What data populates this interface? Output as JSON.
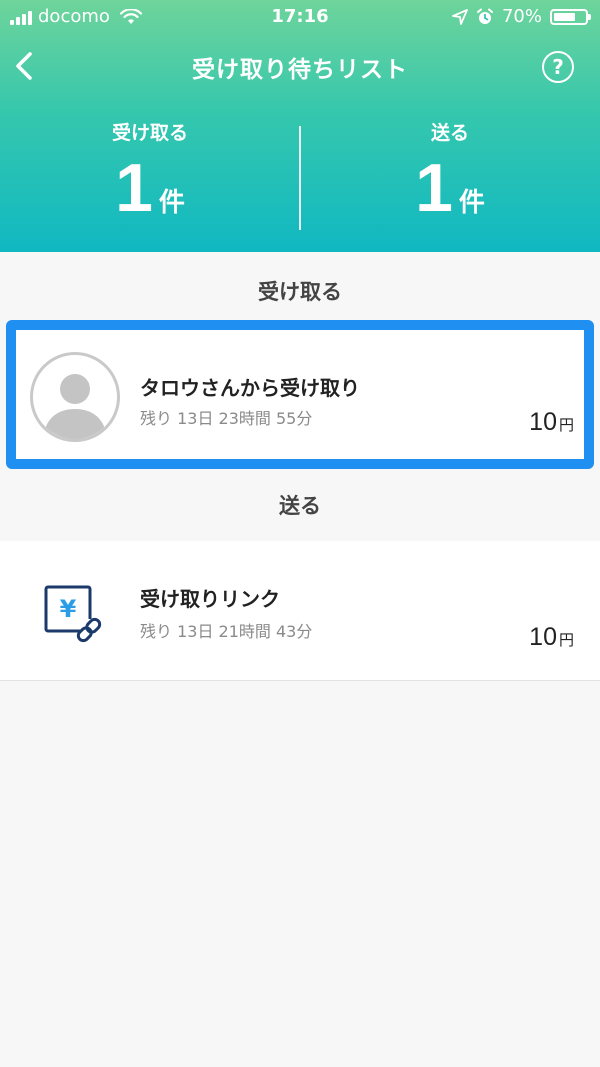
{
  "status_bar": {
    "carrier": "docomo",
    "time": "17:16",
    "battery": "70%",
    "battery_level": 0.7
  },
  "nav": {
    "title": "受け取り待ちリスト",
    "help_label": "?",
    "back_icon": "chevron-left-icon"
  },
  "summary": {
    "receive_label": "受け取る",
    "receive_count": "1",
    "send_label": "送る",
    "send_count": "1",
    "unit": "件"
  },
  "receive_section": {
    "title": "受け取る",
    "item": {
      "title": "タロウさんから受け取り",
      "remaining": "残り 13日 23時間 55分",
      "amount": "10",
      "currency": "円",
      "icon": "avatar-icon"
    }
  },
  "send_section": {
    "title": "送る",
    "item": {
      "title": "受け取りリンク",
      "remaining": "残り 13日 21時間 43分",
      "amount": "10",
      "currency": "円",
      "icon": "yen-link-icon"
    }
  },
  "colors": {
    "header_top": "#6fd49b",
    "header_bottom": "#10b8c2",
    "highlight_border": "#1f8ff1",
    "link_icon_dark": "#1b3a6b",
    "link_icon_accent": "#2a9de6"
  }
}
